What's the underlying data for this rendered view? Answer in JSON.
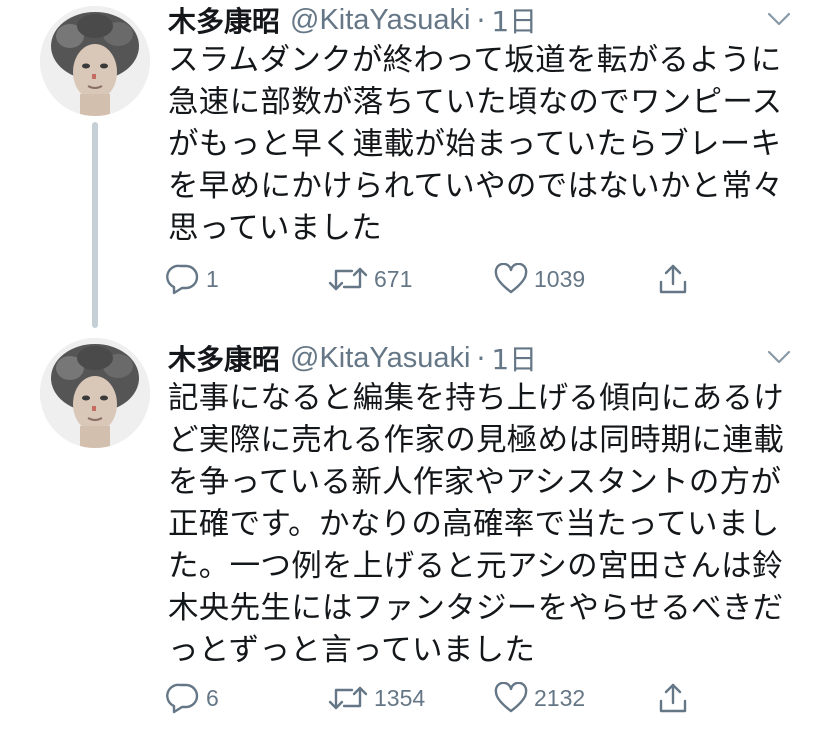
{
  "tweets": [
    {
      "display_name": "木多康昭",
      "handle": "@KitaYasuaki",
      "separator": "·",
      "time": "1日",
      "body_lines": [
        "スラムダンクが終わって坂道を転がるように",
        "急速に部数が落ちていた頃なのでワンピース",
        "がもっと早く連載が始まっていたらブレーキ",
        "を早めにかけられていやのではないかと常々",
        "思っていました"
      ],
      "replies": "1",
      "retweets": "671",
      "likes": "1039"
    },
    {
      "display_name": "木多康昭",
      "handle": "@KitaYasuaki",
      "separator": "·",
      "time": "1日",
      "body_lines": [
        "記事になると編集を持ち上げる傾向にあるけ",
        "ど実際に売れる作家の見極めは同時期に連載",
        "を争っている新人作家やアシスタントの方が",
        "正確です。かなりの高確率で当たっていまし",
        "た。一つ例を上げると元アシの宮田さんは鈴",
        "木央先生にはファンタジーをやらせるべきだ",
        "っとずっと言っていました"
      ],
      "replies": "6",
      "retweets": "1354",
      "likes": "2132"
    }
  ],
  "icons": {
    "reply": "reply-icon",
    "retweet": "retweet-icon",
    "like": "heart-icon",
    "share": "share-icon",
    "menu": "chevron-down-icon"
  },
  "colors": {
    "text": "#14171a",
    "secondary": "#657786",
    "thread_line": "#c4cfd6",
    "background": "#ffffff"
  }
}
